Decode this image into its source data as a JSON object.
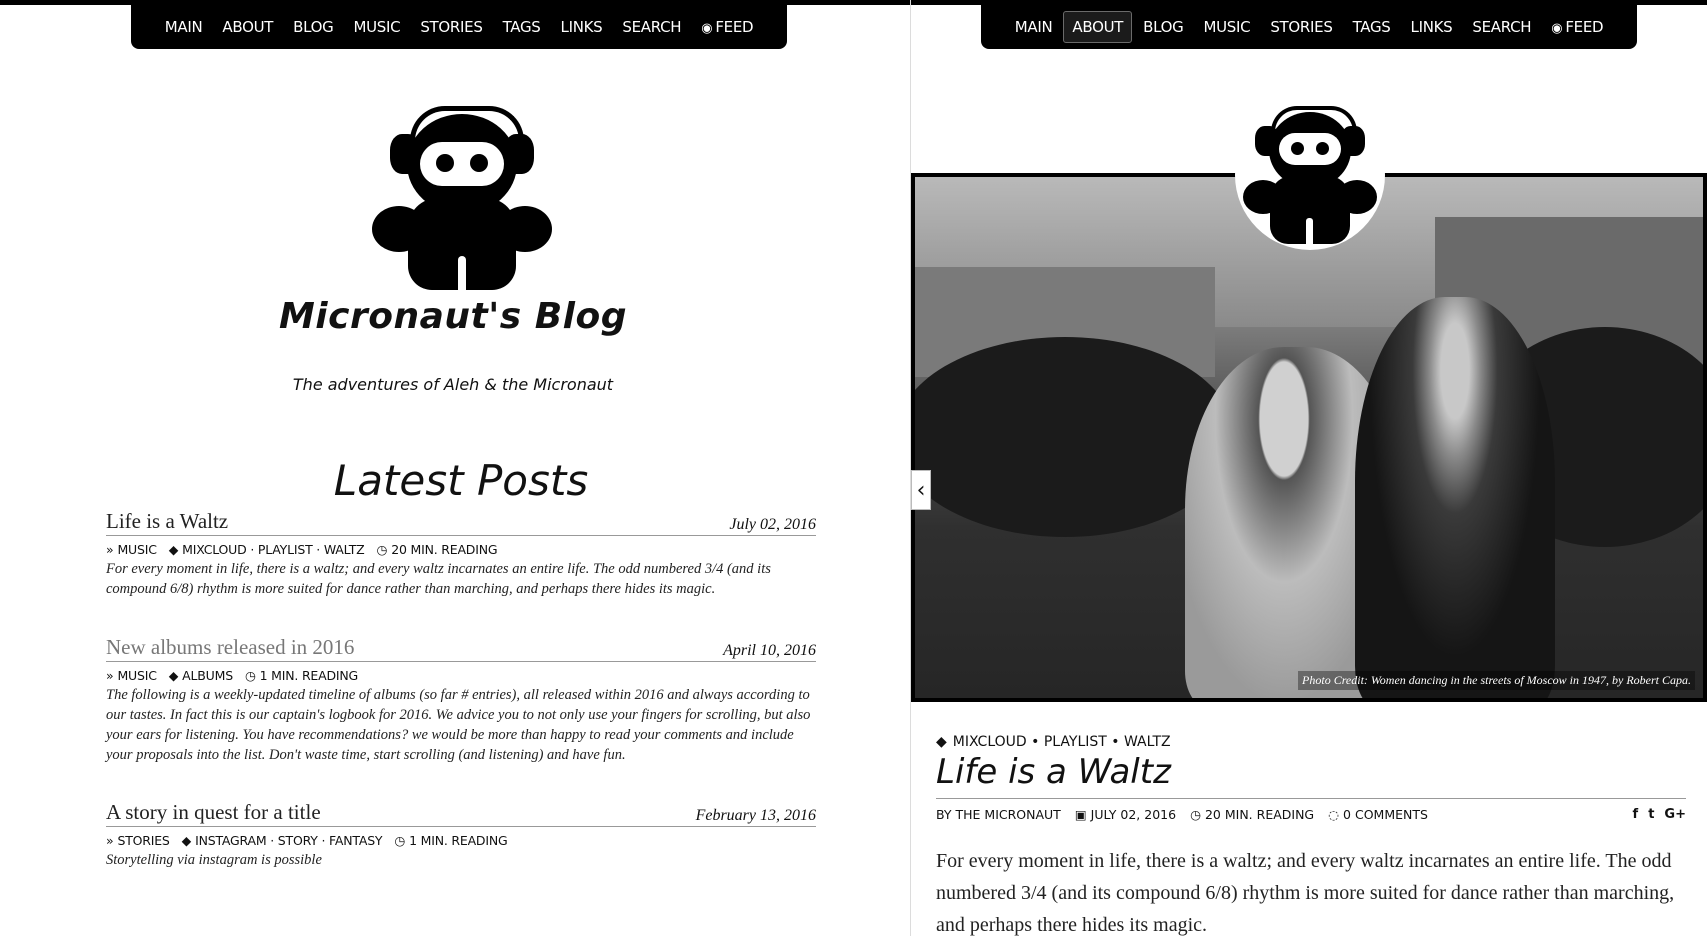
{
  "nav": {
    "left": [
      "MAIN",
      "ABOUT",
      "BLOG",
      "MUSIC",
      "STORIES",
      "TAGS",
      "LINKS",
      "SEARCH",
      "FEED"
    ],
    "right": [
      "MAIN",
      "ABOUT",
      "BLOG",
      "MUSIC",
      "STORIES",
      "TAGS",
      "LINKS",
      "SEARCH",
      "FEED"
    ],
    "right_active": "ABOUT"
  },
  "blog": {
    "title": "Micronaut's Blog",
    "tagline": "The adventures of Aleh & the Micronaut",
    "section_title": "Latest Posts"
  },
  "posts": [
    {
      "title": "Life is a Waltz",
      "date": "July 02, 2016",
      "category": "MUSIC",
      "tags": "MIXCLOUD · PLAYLIST · WALTZ",
      "reading": "20 MIN. READING",
      "excerpt": "For every moment in life, there is a waltz; and every waltz incarnates an entire life. The odd numbered 3/4 (and its compound 6/8) rhythm is more suited for dance rather than marching, and perhaps there hides its magic."
    },
    {
      "title": "New albums released in 2016",
      "date": "April 10, 2016",
      "category": "MUSIC",
      "tags": "ALBUMS",
      "reading": "1 MIN. READING",
      "excerpt": "The following is a weekly-updated timeline of albums (so far # entries), all released within 2016 and always according to our tastes. In fact this is our captain's logbook for 2016. We advice you to not only use your fingers for scrolling, but also your ears for listening. You have recommendations? we would be more than happy to read your comments and include your proposals into the list. Don't waste time, start scrolling (and listening) and have fun."
    },
    {
      "title": "A story in quest for a title",
      "date": "February 13, 2016",
      "category": "STORIES",
      "tags": "INSTAGRAM · STORY · FANTASY",
      "reading": "1 MIN. READING",
      "excerpt": "Storytelling via instagram is possible"
    }
  ],
  "article": {
    "photo_caption": "Photo Credit: Women dancing in the streets of Moscow in 1947, by Robert Capa.",
    "tags": "MIXCLOUD • PLAYLIST • WALTZ",
    "title": "Life is a Waltz",
    "author": "BY THE MICRONAUT",
    "date": "JULY 02, 2016",
    "reading": "20 MIN. READING",
    "comments": "0 COMMENTS",
    "share": [
      "f",
      "t",
      "G+"
    ],
    "body": "For every moment in life, there is a waltz; and every waltz incarnates an entire life. The odd numbered 3/4 (and its compound 6/8) rhythm is more suited for dance rather than marching, and perhaps there hides its magic."
  },
  "icons": {
    "feed": "rss-icon",
    "category": "double-chevron-right-icon",
    "tags": "tags-icon",
    "reading": "clock-icon",
    "date": "calendar-icon",
    "comments": "comments-icon",
    "prev": "chevron-left-icon"
  },
  "colors": {
    "nav_bg": "#000000",
    "page_bg": "#ffffff",
    "text": "#111111"
  }
}
